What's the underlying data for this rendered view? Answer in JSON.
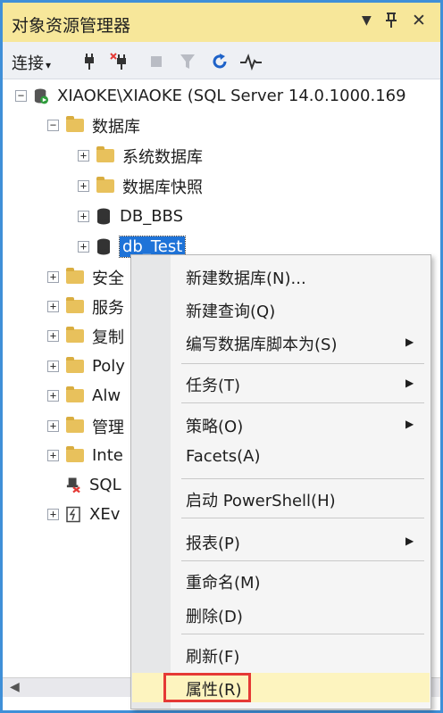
{
  "window": {
    "title": "对象资源管理器",
    "dropdown_glyph": "▼",
    "pin_glyph": "ꟸ",
    "close_glyph": "✕"
  },
  "toolbar": {
    "connect_label": "连接",
    "connect_caret": "▾",
    "icons": [
      "connect-plug-icon",
      "disconnect-plug-icon",
      "stop-icon",
      "filter-icon",
      "refresh-icon",
      "activity-monitor-icon"
    ]
  },
  "tree": {
    "server": "XIAOKE\\XIAOKE (SQL Server 14.0.1000.169",
    "databases": "数据库",
    "system_databases": "系统数据库",
    "snapshots": "数据库快照",
    "db_bbs": "DB_BBS",
    "db_test": "db_Test",
    "security": "安全",
    "server_objects": "服务",
    "replication": "复制",
    "polybase": "Poly",
    "always_on": "Alw",
    "management": "管理",
    "integration": "Inte",
    "sql_agent": "SQL",
    "xevent": "XEv"
  },
  "context_menu": {
    "items": [
      {
        "label": "新建数据库(N)...",
        "submenu": false
      },
      {
        "label": "新建查询(Q)",
        "submenu": false
      },
      {
        "label": "编写数据库脚本为(S)",
        "submenu": true
      },
      {
        "label": "任务(T)",
        "submenu": true
      },
      {
        "label": "策略(O)",
        "submenu": true
      },
      {
        "label": "Facets(A)",
        "submenu": false
      },
      {
        "label": "启动 PowerShell(H)",
        "submenu": false
      },
      {
        "label": "报表(P)",
        "submenu": true
      },
      {
        "label": "重命名(M)",
        "submenu": false
      },
      {
        "label": "删除(D)",
        "submenu": false
      },
      {
        "label": "刷新(F)",
        "submenu": false
      },
      {
        "label": "属性(R)",
        "submenu": false
      }
    ],
    "submenu_arrow": "▶"
  },
  "colors": {
    "title_bar": "#f7e79a",
    "window_border": "#3f8fd8",
    "selection": "#1e73d8",
    "highlight_box": "#e53935",
    "hover_item": "#fdf4bf"
  }
}
